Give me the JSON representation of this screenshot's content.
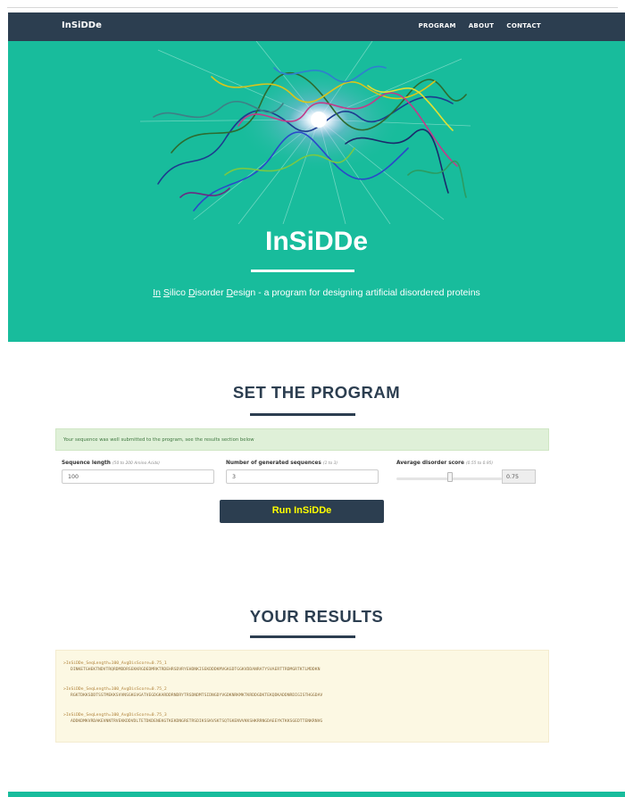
{
  "nav": {
    "brand": "InSiDDe",
    "links": [
      "PROGRAM",
      "ABOUT",
      "CONTACT"
    ]
  },
  "hero": {
    "title": "InSiDDe",
    "subtitle_parts": [
      "In",
      " ",
      "S",
      "ilico ",
      "D",
      "isorder ",
      "D",
      "esign - a program for designing artificial disordered proteins"
    ]
  },
  "program": {
    "heading": "SET THE PROGRAM",
    "alert": "Your sequence was well submitted to the program, see the results section below",
    "length_label": "Sequence length",
    "length_hint": "(50 to 200 Amino Acids)",
    "length_value": "100",
    "count_label": "Number of generated sequences",
    "count_hint": "(1 to 3)",
    "count_value": "3",
    "score_label": "Average disorder score",
    "score_hint": "(0.55 to 0.95)",
    "score_value": "0.75",
    "run_label": "Run InSiDDe"
  },
  "results": {
    "heading": "YOUR RESULTS",
    "entries": [
      {
        "header": ">InSiDDe_SeqLength=100_AvgDisScore=0.75_1",
        "sequence": "DINKETGHEKTNDVTRQRDMDDRSEKKRGDEDMRKTRDEHRSDVRYEHDNKISEKDDDKMVGKGDTGGKVDDANRATYSVAERTTRDMGRTKTLMDDKN"
      },
      {
        "header": ">InSiDDe_SeqLength=100_AvgDisScore=0.75_2",
        "sequence": "RGKTDKKSDDTSSTMEKKSVVNSGKGVGATVEGDGKARDDRNDRYTRSDNDMTSIDNGDYVGDKNRKMKTKRDDGDKTEKQDKADDNRDIGISTHGGDAV"
      },
      {
        "header": ">InSiDDe_SeqLength=100_AvgDisScore=0.75_3",
        "sequence": "ADDKDMKVRDAKEVNNTRVEKKDDVDLTETDKDENEKGTKEKDNGRETRSDIKSSKVSKTSQTGKENVVKKSHKRRNGDAEEYKTKKSGEDTTENKRNVG"
      }
    ]
  },
  "colors": {
    "navy": "#2c3e50",
    "teal": "#18bc9c",
    "button_text": "#ffff00",
    "alert_bg": "#dff0d8",
    "results_bg": "#fcf8e3"
  }
}
